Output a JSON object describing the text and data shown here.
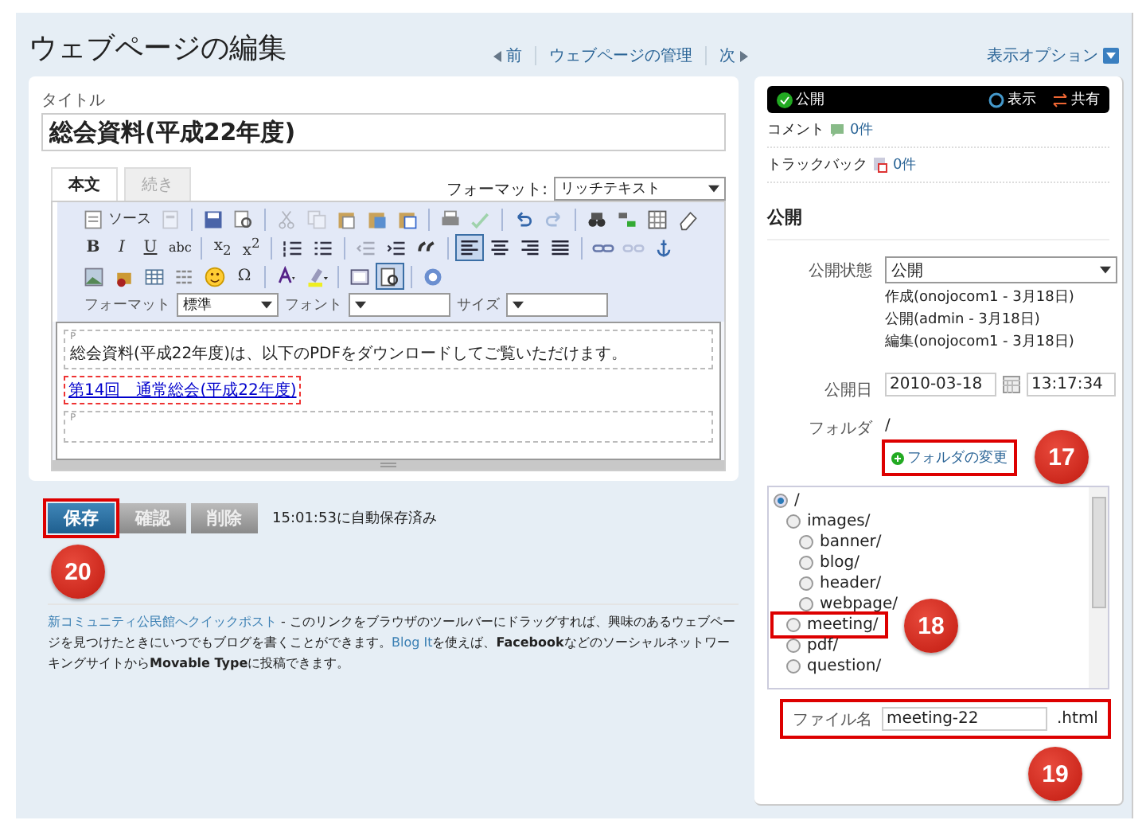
{
  "header": {
    "title": "ウェブページの編集",
    "prev": "前",
    "manage": "ウェブページの管理",
    "next": "次",
    "view_options": "表示オプション"
  },
  "title_field": {
    "label": "タイトル",
    "value": "総会資料(平成22年度)"
  },
  "tabs": [
    {
      "label": "本文",
      "selected": true
    },
    {
      "label": "続き",
      "selected": false
    }
  ],
  "format": {
    "label": "フォーマット:",
    "value": "リッチテキスト"
  },
  "toolbar": [
    {
      "buttons": [
        {
          "kind": "source",
          "label": "ソース",
          "pressed": false,
          "disabled": false
        },
        {
          "kind": "templates",
          "pressed": false,
          "disabled": true
        },
        {
          "kind": "sep"
        },
        {
          "kind": "save",
          "pressed": false,
          "disabled": false
        },
        {
          "kind": "preview",
          "pressed": false,
          "disabled": false
        },
        {
          "kind": "sep"
        },
        {
          "kind": "cut",
          "pressed": false,
          "disabled": true
        },
        {
          "kind": "copy",
          "pressed": false,
          "disabled": true
        },
        {
          "kind": "paste",
          "pressed": false,
          "disabled": false
        },
        {
          "kind": "pastetext",
          "pressed": false,
          "disabled": false
        },
        {
          "kind": "pasteword",
          "pressed": false,
          "disabled": false
        },
        {
          "kind": "sep"
        },
        {
          "kind": "print",
          "pressed": false,
          "disabled": false
        },
        {
          "kind": "spell",
          "pressed": false,
          "disabled": true
        },
        {
          "kind": "sep"
        },
        {
          "kind": "undo",
          "pressed": false,
          "disabled": false
        },
        {
          "kind": "redo",
          "pressed": false,
          "disabled": true
        },
        {
          "kind": "sep"
        },
        {
          "kind": "find",
          "pressed": false,
          "disabled": false
        },
        {
          "kind": "replace",
          "pressed": false,
          "disabled": false
        },
        {
          "kind": "selectall",
          "pressed": false,
          "disabled": false
        },
        {
          "kind": "eraser",
          "pressed": false,
          "disabled": false
        }
      ]
    },
    {
      "buttons": [
        {
          "kind": "bold",
          "label": "B",
          "pressed": false,
          "disabled": false
        },
        {
          "kind": "italic",
          "label": "I",
          "pressed": false,
          "disabled": false
        },
        {
          "kind": "underline",
          "label": "U",
          "pressed": false,
          "disabled": false
        },
        {
          "kind": "strike",
          "label": "abc",
          "pressed": false,
          "disabled": false
        },
        {
          "kind": "sep"
        },
        {
          "kind": "sub",
          "label": "x$_{2}$",
          "pressed": false,
          "disabled": false
        },
        {
          "kind": "sup",
          "label": "x$^{2}$",
          "pressed": false,
          "disabled": false
        },
        {
          "kind": "sep"
        },
        {
          "kind": "numlist",
          "pressed": false,
          "disabled": false
        },
        {
          "kind": "bullist",
          "pressed": false,
          "disabled": false
        },
        {
          "kind": "sep"
        },
        {
          "kind": "outdent",
          "pressed": false,
          "disabled": true
        },
        {
          "kind": "indent",
          "pressed": false,
          "disabled": false
        },
        {
          "kind": "quote",
          "pressed": false,
          "disabled": false
        },
        {
          "kind": "sep"
        },
        {
          "kind": "alignleft",
          "pressed": true,
          "disabled": false
        },
        {
          "kind": "aligncenter",
          "pressed": false,
          "disabled": false
        },
        {
          "kind": "alignright",
          "pressed": false,
          "disabled": false
        },
        {
          "kind": "justify",
          "pressed": false,
          "disabled": false
        },
        {
          "kind": "sep"
        },
        {
          "kind": "link",
          "pressed": false,
          "disabled": false
        },
        {
          "kind": "unlink",
          "pressed": false,
          "disabled": true
        },
        {
          "kind": "anchor",
          "pressed": false,
          "disabled": false
        }
      ]
    },
    {
      "buttons": [
        {
          "kind": "image",
          "pressed": false,
          "disabled": false
        },
        {
          "kind": "flash",
          "pressed": false,
          "disabled": false
        },
        {
          "kind": "table",
          "pressed": false,
          "disabled": false
        },
        {
          "kind": "hr",
          "pressed": false,
          "disabled": false
        },
        {
          "kind": "smiley",
          "pressed": false,
          "disabled": false
        },
        {
          "kind": "special",
          "label": "Ω",
          "pressed": false,
          "disabled": false
        },
        {
          "kind": "sep"
        },
        {
          "kind": "textcolor",
          "pressed": false,
          "disabled": false
        },
        {
          "kind": "bgcolor",
          "pressed": false,
          "disabled": false
        },
        {
          "kind": "sep"
        },
        {
          "kind": "maximize",
          "pressed": false,
          "disabled": false
        },
        {
          "kind": "showblocks",
          "pressed": true,
          "disabled": false
        },
        {
          "kind": "sep"
        },
        {
          "kind": "about",
          "pressed": false,
          "disabled": false
        }
      ]
    }
  ],
  "combos": [
    {
      "label": "フォーマット",
      "value": "標準"
    },
    {
      "label": "フォント"
    },
    {
      "label": "サイズ"
    }
  ],
  "content": [
    {
      "kind": "paragraph",
      "tag": "P",
      "text": "総会資料(平成22年度)は、以下のPDFをダウンロードしてご覧いただけます。"
    },
    {
      "kind": "link",
      "text": "第14回　通常総会(平成22年度)"
    },
    {
      "kind": "paragraph",
      "tag": "P"
    }
  ],
  "actions": [
    {
      "label": "保存",
      "kind": "primary",
      "highlighted": true,
      "callout": "20"
    },
    {
      "label": "確認",
      "kind": "secondary",
      "highlighted": false
    },
    {
      "label": "削除",
      "kind": "secondary",
      "highlighted": false
    }
  ],
  "autosave": "15:01:53に自動保存済み",
  "note": [
    {
      "kind": "link",
      "text": "新コミュニティ公民館へクイックポスト"
    },
    {
      "kind": "text",
      "text": " - このリンクをブラウザのツールバーにドラッグすれば、興味のあるウェブページを見つけたときにいつでもブログを書くことができます。"
    },
    {
      "kind": "link",
      "text": "Blog It"
    },
    {
      "kind": "text",
      "text": "を使えば、**Facebook**などのソーシャルネットワーキングサイトから**Movable Type**に投稿できます。"
    }
  ],
  "status": {
    "label": "公開",
    "view": "表示",
    "share": "共有"
  },
  "feedback": [
    {
      "kind": "comment",
      "label": "コメント",
      "count": "0件"
    },
    {
      "kind": "trackback",
      "label": "トラックバック",
      "count": "0件"
    }
  ],
  "publish": {
    "heading": "公開",
    "status_label": "公開状態",
    "status_value": "公開",
    "history": [
      "作成(onojocom1 - 3月18日)",
      "公開(admin - 3月18日)",
      "編集(onojocom1 - 3月18日)"
    ],
    "date_label": "公開日",
    "date": "2010-03-18",
    "time": "13:17:34",
    "folder_label": "フォルダ",
    "folder": "/",
    "change_folder": {
      "label": "フォルダの変更",
      "highlighted": true,
      "callout": "17"
    }
  },
  "folders": [
    {
      "label": "/",
      "selected": true,
      "highlighted": false,
      "children": [
        {
          "label": "images/",
          "selected": false,
          "highlighted": false,
          "children": [
            {
              "label": "banner/",
              "selected": false,
              "highlighted": false
            },
            {
              "label": "blog/",
              "selected": false,
              "highlighted": false
            },
            {
              "label": "header/",
              "selected": false,
              "highlighted": false
            },
            {
              "label": "webpage/",
              "selected": false,
              "highlighted": false
            }
          ]
        },
        {
          "label": "meeting/",
          "selected": false,
          "highlighted": true,
          "callout": "18"
        },
        {
          "label": "pdf/",
          "selected": false,
          "highlighted": false
        },
        {
          "label": "question/",
          "selected": false,
          "highlighted": false
        }
      ]
    }
  ],
  "filename": {
    "label": "ファイル名",
    "value": "meeting-22",
    "extension": ".html",
    "highlighted": true,
    "callout": "19"
  }
}
